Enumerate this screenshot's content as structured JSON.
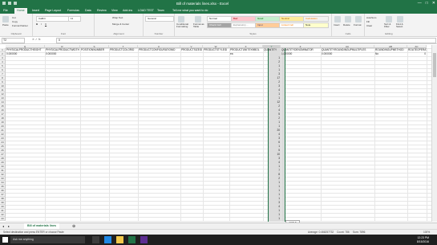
{
  "window": {
    "title": "Bill of materials lines.xlsx - Excel",
    "user": "",
    "controls": [
      "—",
      "□",
      "✕"
    ]
  },
  "tabs": [
    "File",
    "Home",
    "Insert",
    "Page Layout",
    "Formulas",
    "Data",
    "Review",
    "View",
    "Add-ins",
    "LOAD TEST",
    "Team"
  ],
  "tell_me": "Tell me what you want to do",
  "ribbon": {
    "clipboard": {
      "paste": "Paste",
      "cut": "Cut",
      "copy": "Copy",
      "format_painter": "Format Painter",
      "label": "Clipboard"
    },
    "font": {
      "name": "Calibri",
      "size": "11",
      "label": "Font"
    },
    "alignment": {
      "wrap": "Wrap Text",
      "merge": "Merge & Center",
      "label": "Alignment"
    },
    "number": {
      "format": "General",
      "label": "Number"
    },
    "styles": {
      "conditional": "Conditional Formatting",
      "format_table": "Format as Table",
      "label": "Styles",
      "items": [
        "Normal",
        "Bad",
        "Good",
        "Neutral",
        "Calculation",
        "Check Cell",
        "Explanatory ...",
        "Input",
        "Linked Cell",
        "Note"
      ]
    },
    "cells": {
      "insert": "Insert",
      "delete": "Delete",
      "format": "Format",
      "label": "Cells"
    },
    "editing": {
      "autosum": "AutoSum",
      "fill": "Fill",
      "clear": "Clear",
      "sort": "Sort & Filter",
      "find": "Find & Select",
      "label": "Editing"
    }
  },
  "formula_bar": {
    "name_box": "T2",
    "value": "0"
  },
  "columns": [
    {
      "letter": "Q",
      "header": "PHYSICALPRODUCTHEIGHT",
      "r2": "0.000000"
    },
    {
      "letter": "R",
      "header": "PHYSICALPRODUCTWIDTH",
      "r2": "0.000000"
    },
    {
      "letter": "S",
      "header": "POSITIONNUMBER",
      "r2": ""
    },
    {
      "letter": "T",
      "header": "PRODUCTCOLORID",
      "r2": ""
    },
    {
      "letter": "U",
      "header": "PRODUCTCONFIGURATIONID",
      "r2": ""
    },
    {
      "letter": "V",
      "header": "PRODUCTSIZEID",
      "r2": ""
    },
    {
      "letter": "W",
      "header": "PRODUCTSTYLEID",
      "r2": ""
    },
    {
      "letter": "X",
      "header": "PRODUCTUNITSYMBOL",
      "r2": "ea"
    },
    {
      "letter": "Y",
      "header": "QUANTITY",
      "r2": ""
    },
    {
      "letter": "Z",
      "header": "QUANTITYDENOMINATOR",
      "r2": "1.000000"
    },
    {
      "letter": "AA",
      "header": "QUANTITYROUNDINGUPMULTIPLES",
      "r2": "0.000000"
    },
    {
      "letter": "AB",
      "header": "ROUNDINGUPMETHOD",
      "r2": "No"
    },
    {
      "letter": "AC",
      "header": "ROUTEOPERATI",
      "r2": "0"
    }
  ],
  "row_numbers": [
    "1",
    "2",
    "3",
    "4",
    "5",
    "6",
    "7",
    "8",
    "9",
    "10",
    "11",
    "12",
    "13",
    "14",
    "15",
    "16",
    "17",
    "18",
    "19",
    "20",
    "21",
    "22",
    "23",
    "24",
    "25",
    "26",
    "27",
    "28",
    "29",
    "30",
    "31",
    "32",
    "33",
    "34",
    "35",
    "36",
    "37",
    "38",
    "39",
    "40",
    "41",
    "42",
    "43"
  ],
  "quantity_values": [
    "",
    "1",
    "2",
    "1",
    "1",
    "3",
    "17",
    "2",
    "3",
    "4",
    "1",
    "1",
    "12",
    "2",
    "4",
    "5",
    "2",
    "1",
    "1",
    "20",
    "4",
    "3",
    "6",
    "1",
    "5",
    "10",
    "3",
    "4",
    "1",
    "7",
    "8",
    "2",
    "1",
    "1",
    "1",
    "1",
    "1",
    "3",
    "4",
    "1",
    "1",
    "1"
  ],
  "ctrl_label": "(Ctrl) ▾",
  "sheet_tab": "Bill of materials lines",
  "status": {
    "left": "Select destination and press ENTER or choose Paste",
    "average": "Average: 0.466257732",
    "count": "Count: 786",
    "sum": "Sum: 7896",
    "zoom": "100%"
  },
  "taskbar": {
    "search": "Ask me anything",
    "time": "12:23 PM",
    "date": "8/15/2016"
  }
}
